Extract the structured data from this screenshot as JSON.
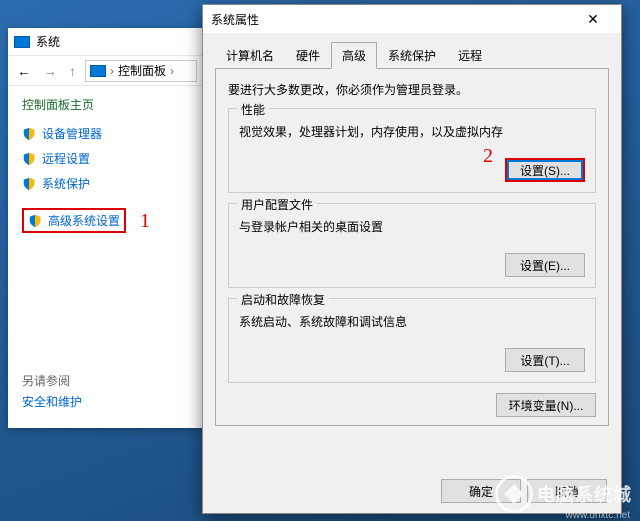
{
  "cp": {
    "title": "系统",
    "path": "控制面板",
    "heading": "控制面板主页",
    "items": [
      {
        "label": "设备管理器"
      },
      {
        "label": "远程设置"
      },
      {
        "label": "系统保护"
      },
      {
        "label": "高级系统设置"
      }
    ],
    "footer_label": "另请参阅",
    "footer_link": "安全和维护"
  },
  "sp": {
    "title": "系统属性",
    "tabs": [
      "计算机名",
      "硬件",
      "高级",
      "系统保护",
      "远程"
    ],
    "note": "要进行大多数更改，你必须作为管理员登录。",
    "groups": {
      "perf": {
        "title": "性能",
        "desc": "视觉效果，处理器计划，内存使用，以及虚拟内存",
        "btn": "设置(S)..."
      },
      "profile": {
        "title": "用户配置文件",
        "desc": "与登录帐户相关的桌面设置",
        "btn": "设置(E)..."
      },
      "startup": {
        "title": "启动和故障恢复",
        "desc": "系统启动、系统故障和调试信息",
        "btn": "设置(T)..."
      }
    },
    "env_btn": "环境变量(N)...",
    "ok": "确定",
    "cancel": "取消"
  },
  "anno": {
    "one": "1",
    "two": "2"
  },
  "watermark": {
    "text": "电脑系统城",
    "url": "www.dnxtc.net"
  }
}
